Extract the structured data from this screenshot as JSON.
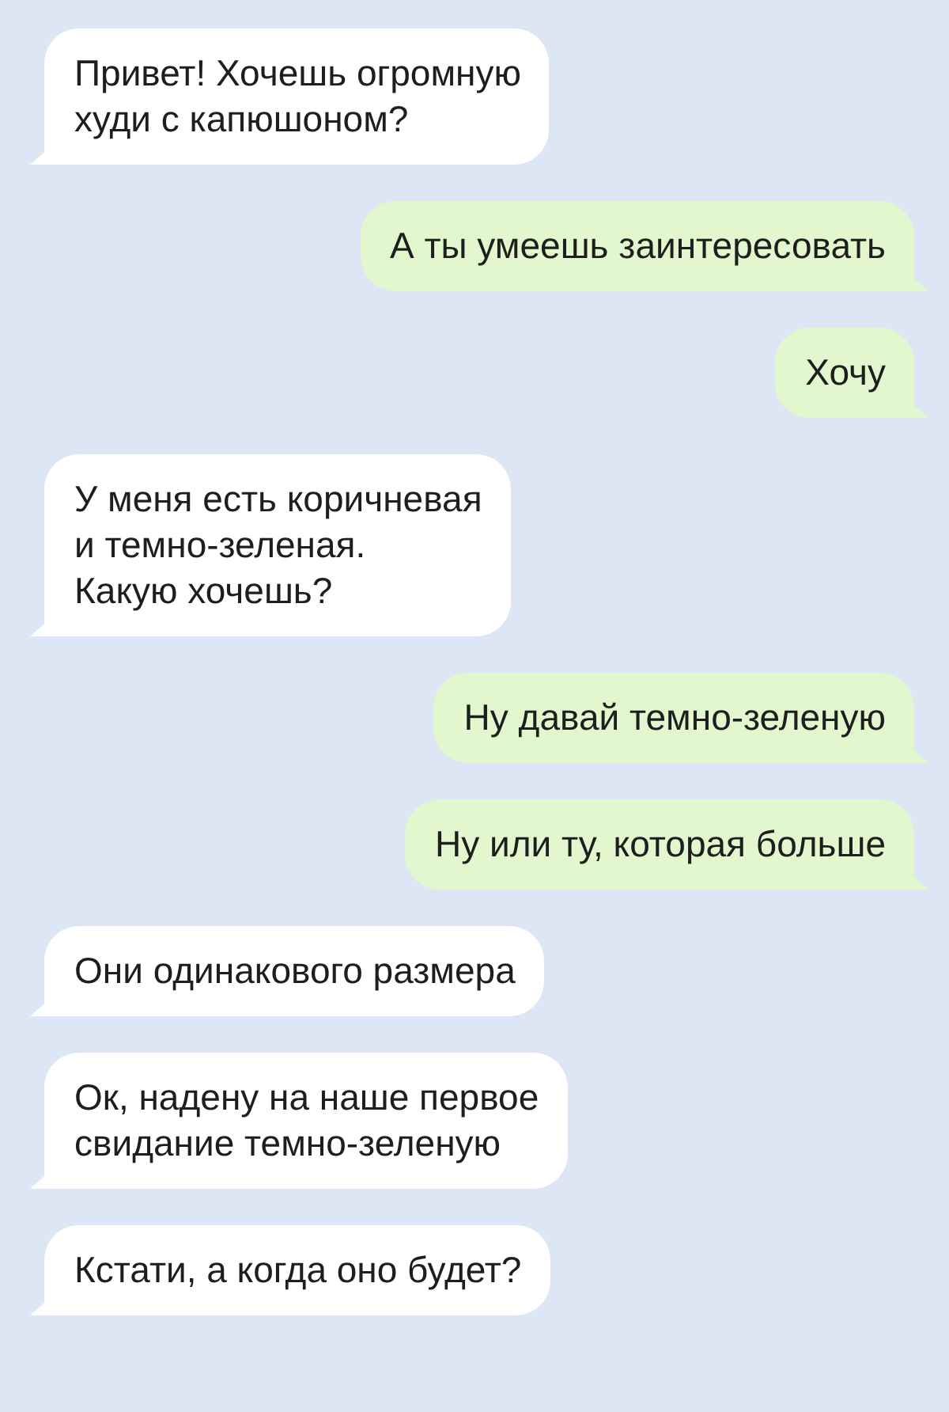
{
  "messages": [
    {
      "kind": "incoming",
      "text": "Привет! Хочешь огромную\nхуди с капюшоном?"
    },
    {
      "kind": "outgoing",
      "text": "А ты умеешь заинтересовать"
    },
    {
      "kind": "outgoing",
      "text": "Хочу"
    },
    {
      "kind": "incoming",
      "text": "У меня есть коричневая\nи темно-зеленая.\nКакую хочешь?"
    },
    {
      "kind": "outgoing",
      "text": "Ну давай темно-зеленую"
    },
    {
      "kind": "outgoing",
      "text": "Ну или ту, которая больше"
    },
    {
      "kind": "incoming",
      "text": "Они одинакового размера"
    },
    {
      "kind": "incoming",
      "text": "Ок, надену на наше первое\nсвидание темно-зеленую"
    },
    {
      "kind": "incoming",
      "text": "Кстати, а когда оно будет?"
    }
  ]
}
